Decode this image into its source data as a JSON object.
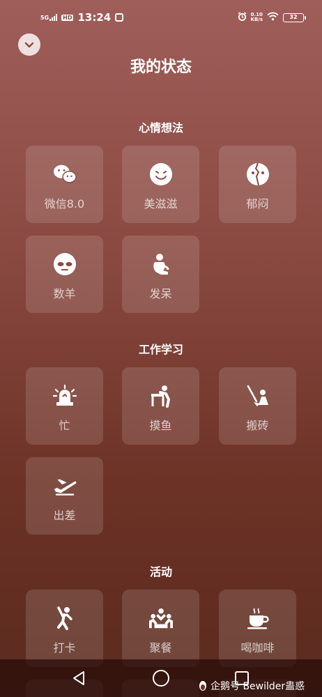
{
  "status_bar": {
    "signal_label": "5G",
    "hd_label": "HD",
    "time": "13:24",
    "net_speed_value": "0.10",
    "net_speed_unit": "KB/s",
    "battery": "32"
  },
  "header": {
    "title": "我的状态"
  },
  "sections": [
    {
      "title": "心情想法",
      "items": [
        {
          "label": "微信8.0",
          "icon": "wechat-icon"
        },
        {
          "label": "美滋滋",
          "icon": "smile-icon"
        },
        {
          "label": "郁闷",
          "icon": "broken-face-icon"
        },
        {
          "label": "数羊",
          "icon": "sheep-icon"
        },
        {
          "label": "发呆",
          "icon": "daze-icon"
        }
      ]
    },
    {
      "title": "工作学习",
      "items": [
        {
          "label": "忙",
          "icon": "siren-icon"
        },
        {
          "label": "摸鱼",
          "icon": "slacking-icon"
        },
        {
          "label": "搬砖",
          "icon": "shovel-icon"
        },
        {
          "label": "出差",
          "icon": "airplane-icon"
        }
      ]
    },
    {
      "title": "活动",
      "items": [
        {
          "label": "打卡",
          "icon": "checkin-icon"
        },
        {
          "label": "聚餐",
          "icon": "dinner-icon"
        },
        {
          "label": "喝咖啡",
          "icon": "coffee-icon"
        }
      ]
    }
  ],
  "watermark": {
    "text": "企鹅号 Bewilder蛊惑"
  }
}
